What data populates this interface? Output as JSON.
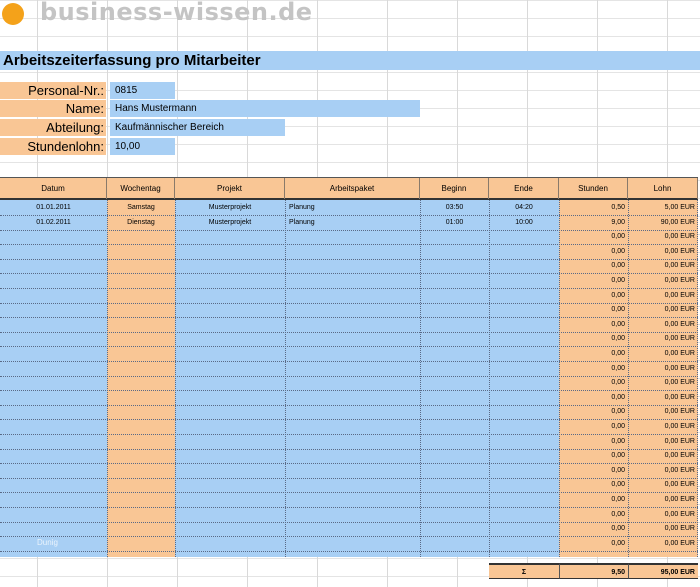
{
  "logo": {
    "text": "business-wissen.de"
  },
  "title": "Arbeitszeiterfassung pro Mitarbeiter",
  "info": [
    {
      "label": "Personal-Nr.:",
      "value": "0815"
    },
    {
      "label": "Name:",
      "value": "Hans Mustermann"
    },
    {
      "label": "Abteilung:",
      "value": "Kaufmännischer Bereich"
    },
    {
      "label": "Stundenlohn:",
      "value": "10,00"
    }
  ],
  "table": {
    "headers": [
      "Datum",
      "Wochentag",
      "Projekt",
      "Arbeitspaket",
      "Beginn",
      "Ende",
      "Stunden",
      "Lohn"
    ],
    "rows": [
      [
        "01.01.2011",
        "Samstag",
        "Musterprojekt",
        "Planung",
        "03:50",
        "04:20",
        "0,50",
        "5,00 EUR"
      ],
      [
        "01.02.2011",
        "Dienstag",
        "Musterprojekt",
        "Planung",
        "01:00",
        "10:00",
        "9,00",
        "90,00 EUR"
      ],
      [
        "",
        "",
        "",
        "",
        "",
        "",
        "0,00",
        "0,00 EUR"
      ],
      [
        "",
        "",
        "",
        "",
        "",
        "",
        "0,00",
        "0,00 EUR"
      ],
      [
        "",
        "",
        "",
        "",
        "",
        "",
        "0,00",
        "0,00 EUR"
      ],
      [
        "",
        "",
        "",
        "",
        "",
        "",
        "0,00",
        "0,00 EUR"
      ],
      [
        "",
        "",
        "",
        "",
        "",
        "",
        "0,00",
        "0,00 EUR"
      ],
      [
        "",
        "",
        "",
        "",
        "",
        "",
        "0,00",
        "0,00 EUR"
      ],
      [
        "",
        "",
        "",
        "",
        "",
        "",
        "0,00",
        "0,00 EUR"
      ],
      [
        "",
        "",
        "",
        "",
        "",
        "",
        "0,00",
        "0,00 EUR"
      ],
      [
        "",
        "",
        "",
        "",
        "",
        "",
        "0,00",
        "0,00 EUR"
      ],
      [
        "",
        "",
        "",
        "",
        "",
        "",
        "0,00",
        "0,00 EUR"
      ],
      [
        "",
        "",
        "",
        "",
        "",
        "",
        "0,00",
        "0,00 EUR"
      ],
      [
        "",
        "",
        "",
        "",
        "",
        "",
        "0,00",
        "0,00 EUR"
      ],
      [
        "",
        "",
        "",
        "",
        "",
        "",
        "0,00",
        "0,00 EUR"
      ],
      [
        "",
        "",
        "",
        "",
        "",
        "",
        "0,00",
        "0,00 EUR"
      ],
      [
        "",
        "",
        "",
        "",
        "",
        "",
        "0,00",
        "0,00 EUR"
      ],
      [
        "",
        "",
        "",
        "",
        "",
        "",
        "0,00",
        "0,00 EUR"
      ],
      [
        "",
        "",
        "",
        "",
        "",
        "",
        "0,00",
        "0,00 EUR"
      ],
      [
        "",
        "",
        "",
        "",
        "",
        "",
        "0,00",
        "0,00 EUR"
      ],
      [
        "",
        "",
        "",
        "",
        "",
        "",
        "0,00",
        "0,00 EUR"
      ],
      [
        "",
        "",
        "",
        "",
        "",
        "",
        "0,00",
        "0,00 EUR"
      ],
      [
        "",
        "",
        "",
        "",
        "",
        "",
        "0,00",
        "0,00 EUR"
      ],
      [
        "",
        "",
        "",
        "",
        "",
        "",
        "0,00",
        "0,00 EUR"
      ]
    ],
    "sum": {
      "symbol": "Σ",
      "hours": "9,50",
      "wage": "95,00 EUR"
    }
  },
  "watermark": "Dunig",
  "colors": {
    "blue": "#a8cff4",
    "orange": "#f9c695",
    "logo_dot": "#f4a21a"
  }
}
